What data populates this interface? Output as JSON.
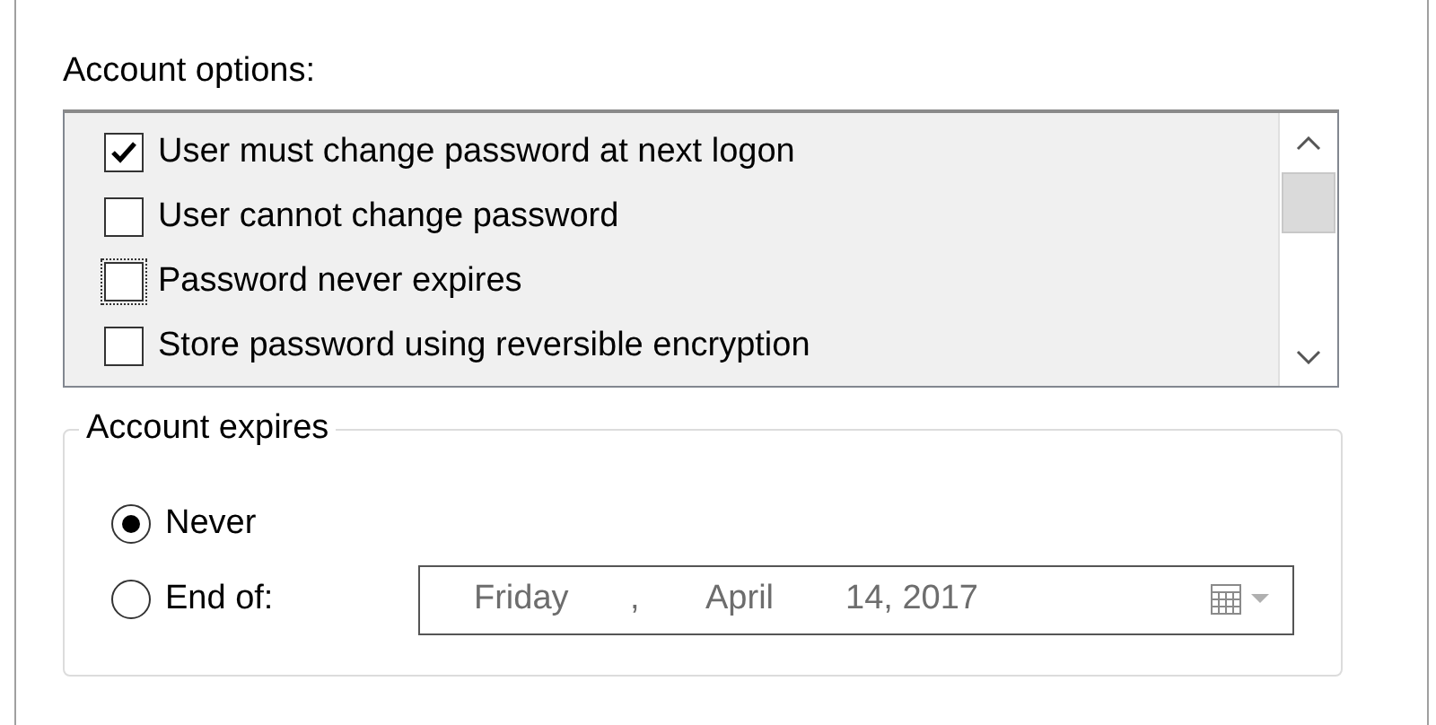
{
  "account_options": {
    "label": "Account options:",
    "items": [
      {
        "label": "User must change password at next logon",
        "checked": true,
        "focused": false
      },
      {
        "label": "User cannot change password",
        "checked": false,
        "focused": false
      },
      {
        "label": "Password never expires",
        "checked": false,
        "focused": true
      },
      {
        "label": "Store password using reversible encryption",
        "checked": false,
        "focused": false
      }
    ]
  },
  "account_expires": {
    "legend": "Account expires",
    "options": [
      {
        "label": "Never",
        "selected": true
      },
      {
        "label": "End of:",
        "selected": false
      }
    ],
    "date_picker": {
      "disabled": true,
      "parts": [
        "Friday",
        ",",
        "April",
        "14, 2017"
      ]
    }
  }
}
